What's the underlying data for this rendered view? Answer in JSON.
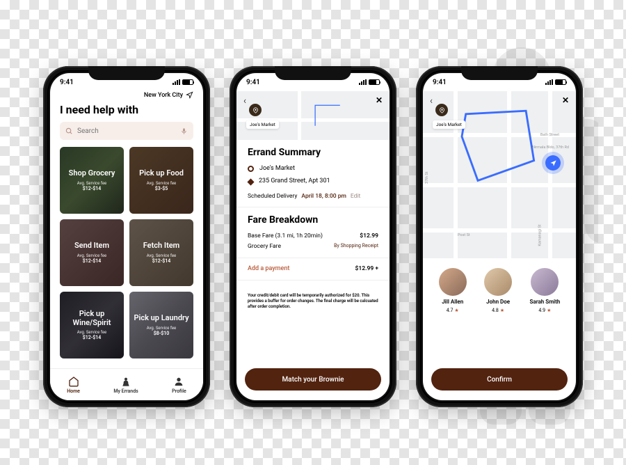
{
  "status": {
    "time": "9:41"
  },
  "screen1": {
    "location": "New York City",
    "title": "I need help with",
    "search_placeholder": "Search",
    "tiles": [
      {
        "title": "Shop Grocery",
        "fee_label": "Avg. Service fee",
        "fee": "$12-$14"
      },
      {
        "title": "Pick up Food",
        "fee_label": "Avg. Service fee",
        "fee": "$3-$5"
      },
      {
        "title": "Send Item",
        "fee_label": "Avg. Service fee",
        "fee": "$12-$14"
      },
      {
        "title": "Fetch Item",
        "fee_label": "Avg. Service fee",
        "fee": "$12-$14"
      },
      {
        "title": "Pick up Wine/Spirit",
        "fee_label": "Avg. Service fee",
        "fee": "$12-$14"
      },
      {
        "title": "Pick up Laundry",
        "fee_label": "Avg. Service fee",
        "fee": "$8-$10"
      }
    ],
    "tabs": {
      "home": "Home",
      "errands": "My Errands",
      "profile": "Profile"
    }
  },
  "screen2": {
    "pin_label": "Joe's Market",
    "summary_title": "Errand Summary",
    "loc1": "Joe's Market",
    "loc2": "235 Grand Street, Apt 301",
    "sched_label": "Scheduled Delivery",
    "sched_value": "April 18, 8:00 pm",
    "sched_edit": "Edit",
    "fare_title": "Fare Breakdown",
    "base_label": "Base Fare (3.1 mi, 1h 20min)",
    "base_value": "$12.99",
    "groc_label": "Grocery Fare",
    "groc_value": "By Shopping Receipt",
    "addpay_label": "Add a payment",
    "addpay_value": "$12.99 +",
    "disclaimer": "Your credit/debit card will be temporarily authorized for $20. This provides a buffer for order changes. The final charge will be calcuated after order completion.",
    "button": "Match your Brownie"
  },
  "screen3": {
    "pin_label": "Joe's Market",
    "streets": [
      "Bath Street",
      "Nirmala Bldo, 37th Rd",
      "37th St",
      "Post St",
      "Kamanagi St"
    ],
    "brownies": [
      {
        "name": "Jill Allen",
        "rating": "4.7"
      },
      {
        "name": "John Doe",
        "rating": "4.8"
      },
      {
        "name": "Sarah Smith",
        "rating": "4.9"
      }
    ],
    "button": "Confirm"
  }
}
